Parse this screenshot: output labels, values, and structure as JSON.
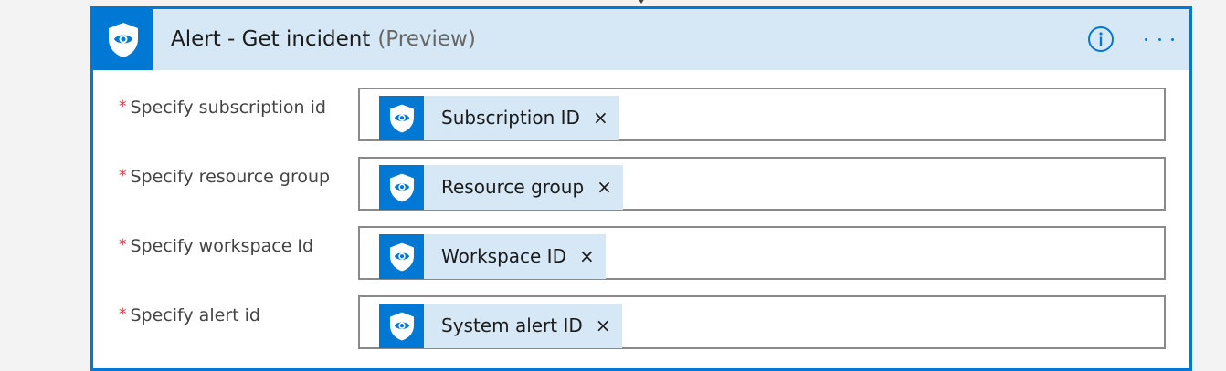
{
  "header": {
    "title": "Alert - Get incident",
    "preview_tag": "(Preview)",
    "header_icon": "sentinel-shield-icon",
    "info_icon": "info-icon",
    "more_icon": "more-options-icon"
  },
  "fields": [
    {
      "label": "Specify subscription id",
      "required_marker": "*",
      "token_label": "Subscription ID",
      "token_icon": "sentinel-shield-icon",
      "remove_glyph": "×"
    },
    {
      "label": "Specify resource group",
      "required_marker": "*",
      "token_label": "Resource group",
      "token_icon": "sentinel-shield-icon",
      "remove_glyph": "×"
    },
    {
      "label": "Specify workspace Id",
      "required_marker": "*",
      "token_label": "Workspace ID",
      "token_icon": "sentinel-shield-icon",
      "remove_glyph": "×"
    },
    {
      "label": "Specify alert id",
      "required_marker": "*",
      "token_label": "System alert ID",
      "token_icon": "sentinel-shield-icon",
      "remove_glyph": "×"
    }
  ],
  "colors": {
    "accent": "#0078d4",
    "header_bg": "#d6e8f5",
    "required": "#d13438",
    "input_border": "#8a8a8a"
  }
}
